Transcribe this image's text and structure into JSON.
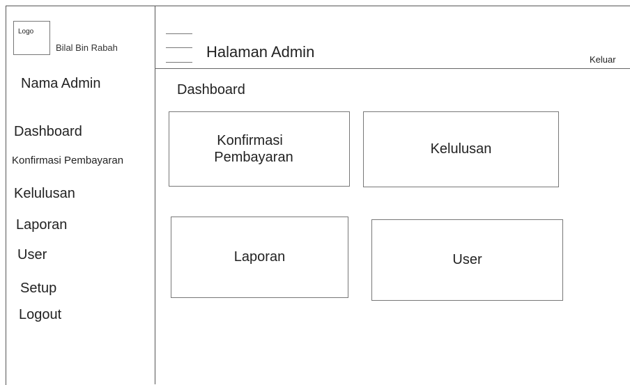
{
  "sidebar": {
    "logo_label": "Logo",
    "brand_name": "Bilal Bin Rabah",
    "admin_name": "Nama Admin",
    "items": [
      {
        "label": "Dashboard"
      },
      {
        "label": "Konfirmasi Pembayaran"
      },
      {
        "label": "Kelulusan"
      },
      {
        "label": "Laporan"
      },
      {
        "label": "User"
      },
      {
        "label": "Setup"
      },
      {
        "label": "Logout"
      }
    ]
  },
  "header": {
    "title": "Halaman Admin",
    "logout_label": "Keluar",
    "menu_icon": "hamburger-icon"
  },
  "main": {
    "section_title": "Dashboard",
    "cards": [
      {
        "line1": "Konfirmasi",
        "line2": "Pembayaran"
      },
      {
        "label": "Kelulusan"
      },
      {
        "label": "Laporan"
      },
      {
        "label": "User"
      }
    ]
  }
}
